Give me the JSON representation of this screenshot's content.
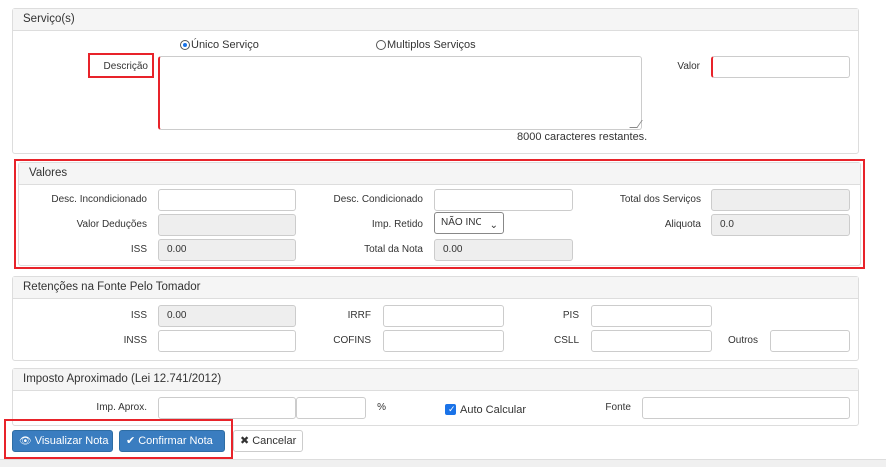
{
  "servicos": {
    "title": "Serviço(s)",
    "radio_unico": "Único Serviço",
    "radio_multiplos": "Multiplos Serviços",
    "descricao_label": "Descrição",
    "valor_label": "Valor",
    "chars_remaining": "8000 caracteres restantes.",
    "descricao_value": "",
    "valor_value": ""
  },
  "valores": {
    "title": "Valores",
    "desc_incondicionado_label": "Desc. Incondicionado",
    "desc_condicionado_label": "Desc. Condicionado",
    "total_servicos_label": "Total dos Serviços",
    "valor_deducoes_label": "Valor Deduções",
    "imp_retido_label": "Imp. Retido",
    "imp_retido_selected": "NÃO INC",
    "aliquota_label": "Aliquota",
    "aliquota_value": "0.0",
    "iss_label": "ISS",
    "iss_value": "0.00",
    "total_nota_label": "Total da Nota",
    "total_nota_value": "0.00"
  },
  "retencoes": {
    "title": "Retenções na Fonte Pelo Tomador",
    "iss_label": "ISS",
    "iss_value": "0.00",
    "irrf_label": "IRRF",
    "pis_label": "PIS",
    "inss_label": "INSS",
    "cofins_label": "COFINS",
    "csll_label": "CSLL",
    "outros_label": "Outros"
  },
  "imposto": {
    "title": "Imposto Aproximado (Lei 12.741/2012)",
    "imp_aprox_label": "Imp. Aprox.",
    "percent_label": "%",
    "auto_calcular_label": "Auto Calcular",
    "auto_calcular_checked": true,
    "fonte_label": "Fonte"
  },
  "actions": {
    "visualizar_label": "Visualizar Nota",
    "confirmar_label": "Confirmar Nota",
    "cancelar_label": "Cancelar"
  },
  "colors": {
    "highlight": "#e8232a",
    "primary": "#3a7dc0",
    "readonly_bg": "#eeeeee"
  }
}
